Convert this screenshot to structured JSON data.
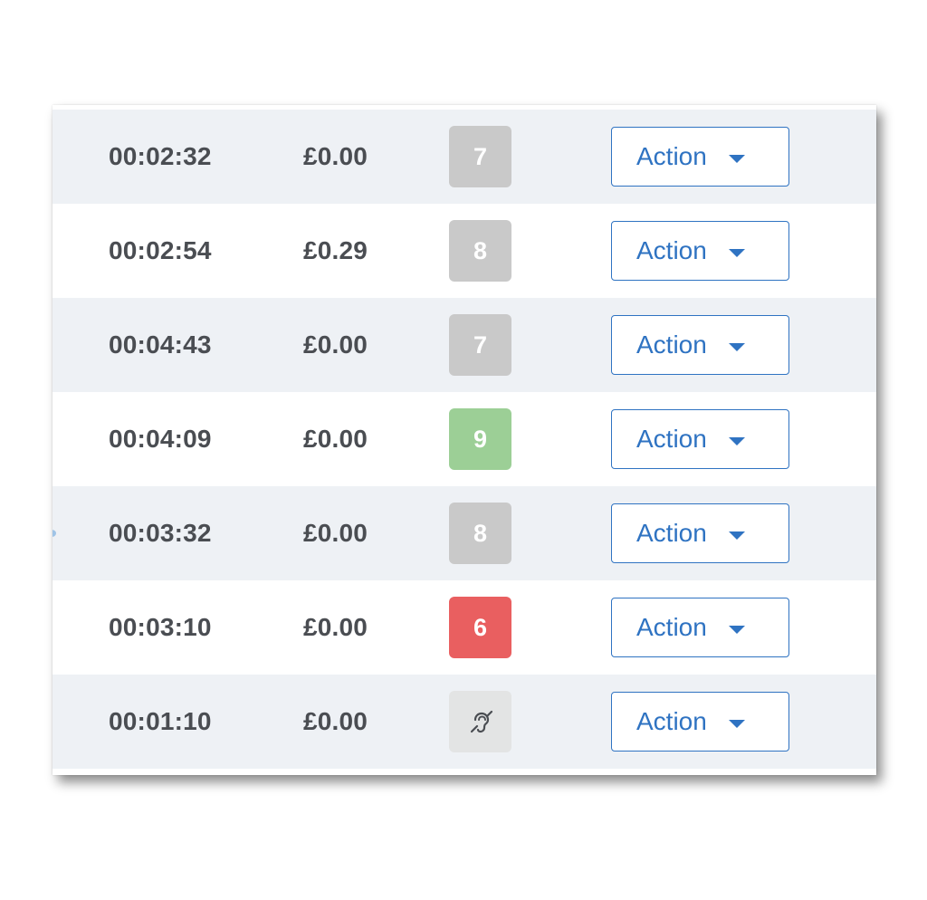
{
  "rows": [
    {
      "time": "00:02:32",
      "cost": "£0.00",
      "score": "7",
      "badge": "grey",
      "action": "Action",
      "shaded": true
    },
    {
      "time": "00:02:54",
      "cost": "£0.29",
      "score": "8",
      "badge": "grey",
      "action": "Action",
      "shaded": false
    },
    {
      "time": "00:04:43",
      "cost": "£0.00",
      "score": "7",
      "badge": "grey",
      "action": "Action",
      "shaded": true
    },
    {
      "time": "00:04:09",
      "cost": "£0.00",
      "score": "9",
      "badge": "green",
      "action": "Action",
      "shaded": false
    },
    {
      "time": "00:03:32",
      "cost": "£0.00",
      "score": "8",
      "badge": "grey",
      "action": "Action",
      "shaded": true
    },
    {
      "time": "00:03:10",
      "cost": "£0.00",
      "score": "6",
      "badge": "red",
      "action": "Action",
      "shaded": false
    },
    {
      "time": "00:01:10",
      "cost": "£0.00",
      "score": "",
      "badge": "icon",
      "icon": "hearing-impaired-icon",
      "action": "Action",
      "shaded": true
    }
  ],
  "colors": {
    "row_shaded": "#eef1f5",
    "text": "#4a4d52",
    "accent": "#2f73c2",
    "badge_grey": "#c9c9c9",
    "badge_green": "#9ccf96",
    "badge_red": "#e95f60",
    "badge_icon_bg": "#e3e4e4"
  }
}
